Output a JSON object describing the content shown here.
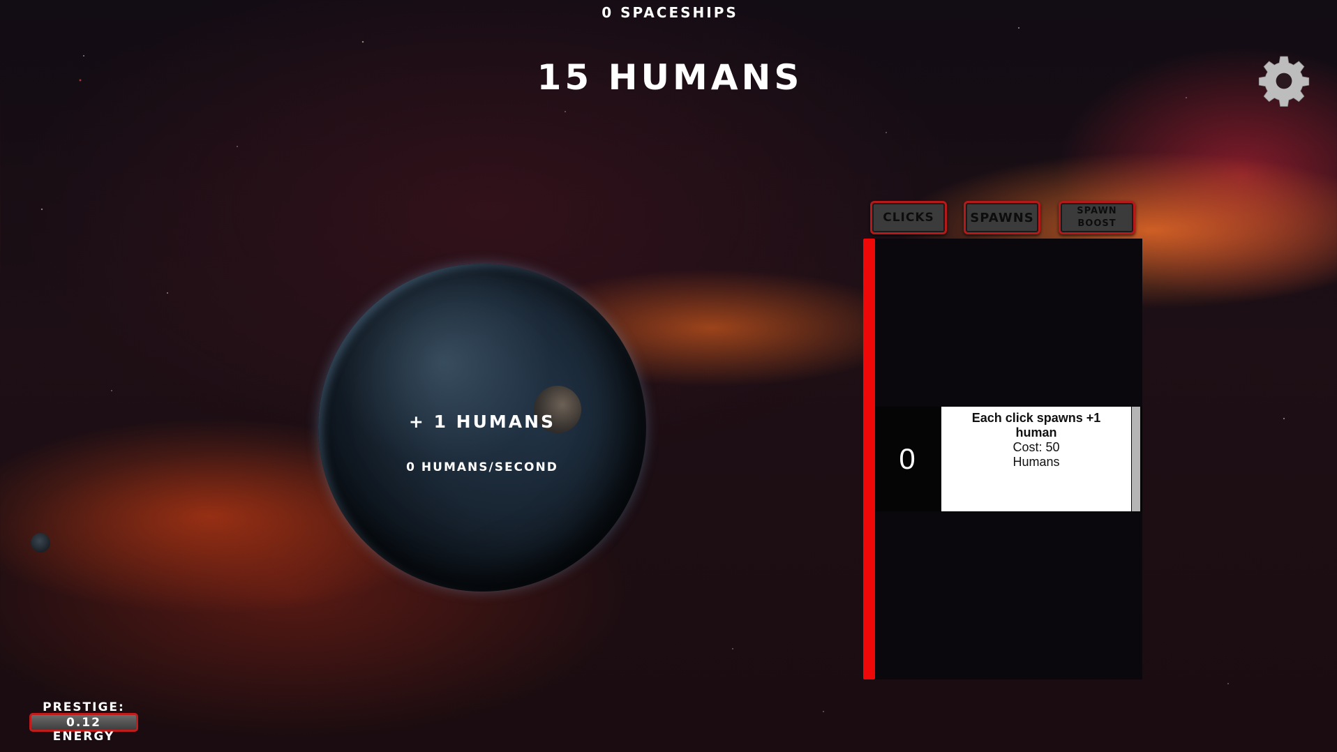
{
  "header": {
    "spaceships_text": "0 SPACESHIPS",
    "humans_text": "15 HUMANS"
  },
  "planet": {
    "click_gain_text": "+ 1 HUMANS",
    "rate_text": "0 HUMANS/SECOND"
  },
  "tabs": [
    {
      "label_line1": "CLICKS",
      "label_line2": ""
    },
    {
      "label_line1": "SPAWNS",
      "label_line2": ""
    },
    {
      "label_line1": "SPAWN",
      "label_line2": "BOOST"
    }
  ],
  "upgrade": {
    "owned_count": "0",
    "description": "Each click spawns +1 human",
    "cost_line1": "Cost: 50",
    "cost_line2": "Humans"
  },
  "prestige": {
    "label": "PRESTIGE:",
    "value": "0.12",
    "unit": "ENERGY"
  },
  "icons": {
    "settings": "gear-icon"
  },
  "colors": {
    "accent_red": "#ee0808",
    "tab_border": "#b51a1a",
    "panel_bg": "#0b080d"
  }
}
